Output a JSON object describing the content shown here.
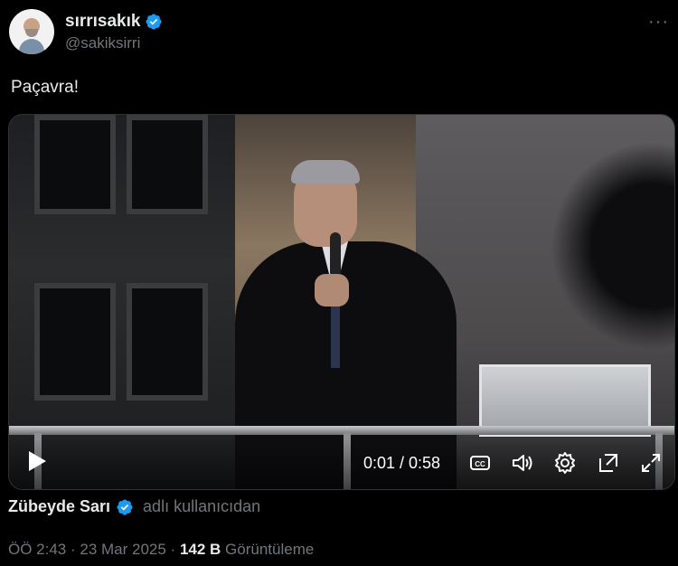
{
  "author": {
    "display_name": "sırrısakık",
    "handle": "@sakiksirri",
    "more_icon": "more-horizontal-icon"
  },
  "tweet": {
    "text": "Paçavra!"
  },
  "video": {
    "time": "0:01 / 0:58",
    "progress_fraction": 0.017
  },
  "attribution": {
    "name": "Zübeyde Sarı",
    "suffix": "adlı kullanıcıdan"
  },
  "meta": {
    "time": "ÖÖ 2:43",
    "sep1": " · ",
    "date": "23 Mar 2025",
    "sep2": " · ",
    "views_count": "142 B",
    "views_label": "Görüntüleme"
  },
  "colors": {
    "verified": "#1d9bf0",
    "secondary_text": "#71767b",
    "primary_text": "#e7e9ea",
    "background": "#000000"
  }
}
